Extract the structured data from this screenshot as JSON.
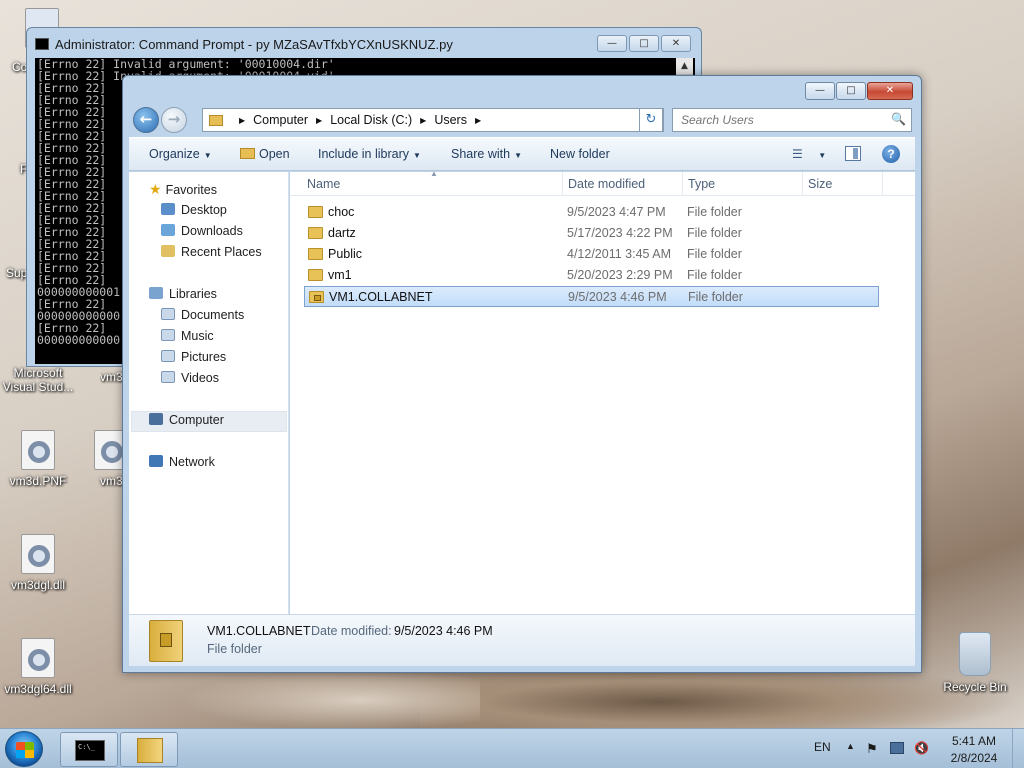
{
  "desktop": {
    "icons": [
      {
        "label": "Microsoft Visual Stud..."
      },
      {
        "label": "vm3d.PNF"
      },
      {
        "label": "vm3dgl.dll"
      },
      {
        "label": "vm3dgl64.dll"
      },
      {
        "label": "Recycle Bin"
      }
    ],
    "partial_labels": [
      "Co",
      "F",
      "Sup",
      "vm3",
      "vm3"
    ]
  },
  "cmd": {
    "title": "Administrator:  Command Prompt - py  MZaSAvTfxbYCXnUSKNUZ.py",
    "lines": [
      "[Errno 22] Invalid argument: '00010004.dir'",
      "[Errno 22] Invalid argument: '00010004.vid'",
      "[Errno 22]",
      "[Errno 22]",
      "[Errno 22]",
      "[Errno 22]",
      "[Errno 22]",
      "[Errno 22]",
      "[Errno 22]",
      "[Errno 22]",
      "[Errno 22]",
      "[Errno 22]",
      "[Errno 22]",
      "[Errno 22]",
      "[Errno 22]",
      "[Errno 22]",
      "[Errno 22]",
      "[Errno 22]",
      "[Errno 22]",
      "000000000001",
      "[Errno 22]",
      "000000000000",
      "[Errno 22]",
      "000000000000"
    ]
  },
  "explorer": {
    "address": {
      "crumbs": [
        "Computer",
        "Local Disk (C:)",
        "Users"
      ]
    },
    "search": {
      "placeholder": "Search Users"
    },
    "toolbar": {
      "organize": "Organize",
      "open": "Open",
      "include": "Include in library",
      "share": "Share with",
      "new_folder": "New folder"
    },
    "nav": {
      "favorites": "Favorites",
      "desktop": "Desktop",
      "downloads": "Downloads",
      "recent": "Recent Places",
      "libraries": "Libraries",
      "documents": "Documents",
      "music": "Music",
      "pictures": "Pictures",
      "videos": "Videos",
      "computer": "Computer",
      "network": "Network"
    },
    "columns": {
      "name": "Name",
      "date": "Date modified",
      "type": "Type",
      "size": "Size"
    },
    "rows": [
      {
        "name": "choc",
        "date": "9/5/2023 4:47 PM",
        "type": "File folder"
      },
      {
        "name": "dartz",
        "date": "5/17/2023 4:22 PM",
        "type": "File folder"
      },
      {
        "name": "Public",
        "date": "4/12/2011 3:45 AM",
        "type": "File folder"
      },
      {
        "name": "vm1",
        "date": "5/20/2023 2:29 PM",
        "type": "File folder"
      },
      {
        "name": "VM1.COLLABNET",
        "date": "9/5/2023 4:46 PM",
        "type": "File folder"
      }
    ],
    "details": {
      "name": "VM1.COLLABNET",
      "date_label": "Date modified:",
      "date_value": "9/5/2023 4:46 PM",
      "type": "File folder"
    }
  },
  "taskbar": {
    "lang": "EN",
    "time": "5:41 AM",
    "date": "2/8/2024"
  }
}
